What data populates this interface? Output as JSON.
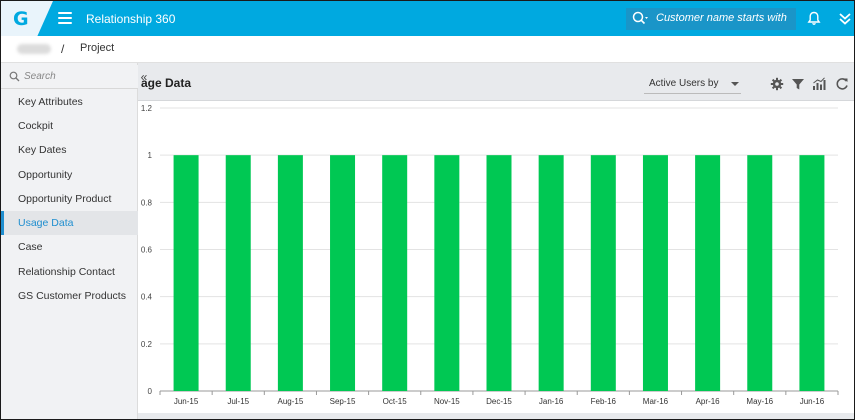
{
  "app": {
    "logo_letter": "G",
    "title": "Relationship 360"
  },
  "search": {
    "placeholder": "Customer name starts with"
  },
  "breadcrumb": {
    "separator": "/",
    "current": "Project"
  },
  "sidebar": {
    "search_placeholder": "Search",
    "collapse_glyph": "«",
    "items": [
      {
        "label": "Key Attributes",
        "active": false
      },
      {
        "label": "Cockpit",
        "active": false
      },
      {
        "label": "Key Dates",
        "active": false
      },
      {
        "label": "Opportunity",
        "active": false
      },
      {
        "label": "Opportunity Product",
        "active": false
      },
      {
        "label": "Usage Data",
        "active": true
      },
      {
        "label": "Case",
        "active": false
      },
      {
        "label": "Relationship Contact",
        "active": false
      },
      {
        "label": "GS Customer Products",
        "active": false
      }
    ]
  },
  "main": {
    "section_title": "age Data",
    "measure_select": "Active Users by",
    "tools": [
      "gear-icon",
      "filter-icon",
      "chart-type-icon",
      "refresh-icon"
    ]
  },
  "colors": {
    "topbar": "#00a9e0",
    "bar": "#00c853",
    "active_item": "#1f8ecf"
  },
  "chart_data": {
    "type": "bar",
    "categories": [
      "Jun-15",
      "Jul-15",
      "Aug-15",
      "Sep-15",
      "Oct-15",
      "Nov-15",
      "Dec-15",
      "Jan-16",
      "Feb-16",
      "Mar-16",
      "Apr-16",
      "May-16",
      "Jun-16"
    ],
    "values": [
      1,
      1,
      1,
      1,
      1,
      1,
      1,
      1,
      1,
      1,
      1,
      1,
      1
    ],
    "yticks": [
      "0",
      "0.2",
      "0.4",
      "0.6",
      "0.8",
      "1",
      "1.2"
    ],
    "ylim": [
      0,
      1.2
    ],
    "grid": true,
    "legend": "none"
  }
}
